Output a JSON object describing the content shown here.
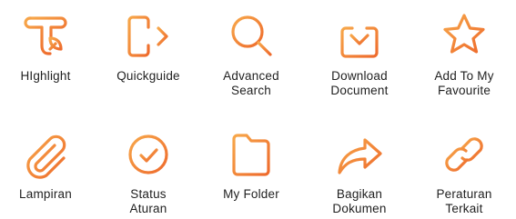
{
  "accent_gradient": {
    "start": "#f7a74a",
    "end": "#ee6a2c"
  },
  "label_color": "#1f1f1f",
  "tiles": [
    {
      "icon": "highlight-icon",
      "label": "HIghlight"
    },
    {
      "icon": "exit-arrow-icon",
      "label": "Quickguide"
    },
    {
      "icon": "search-icon",
      "label": "Advanced\nSearch"
    },
    {
      "icon": "download-icon",
      "label": "Download\nDocument"
    },
    {
      "icon": "star-icon",
      "label": "Add To My\nFavourite"
    },
    {
      "icon": "paperclip-icon",
      "label": "Lampiran"
    },
    {
      "icon": "check-circle-icon",
      "label": "Status\nAturan"
    },
    {
      "icon": "folder-icon",
      "label": "My Folder"
    },
    {
      "icon": "share-arrow-icon",
      "label": "Bagikan\nDokumen"
    },
    {
      "icon": "link-icon",
      "label": "Peraturan\nTerkait"
    }
  ]
}
